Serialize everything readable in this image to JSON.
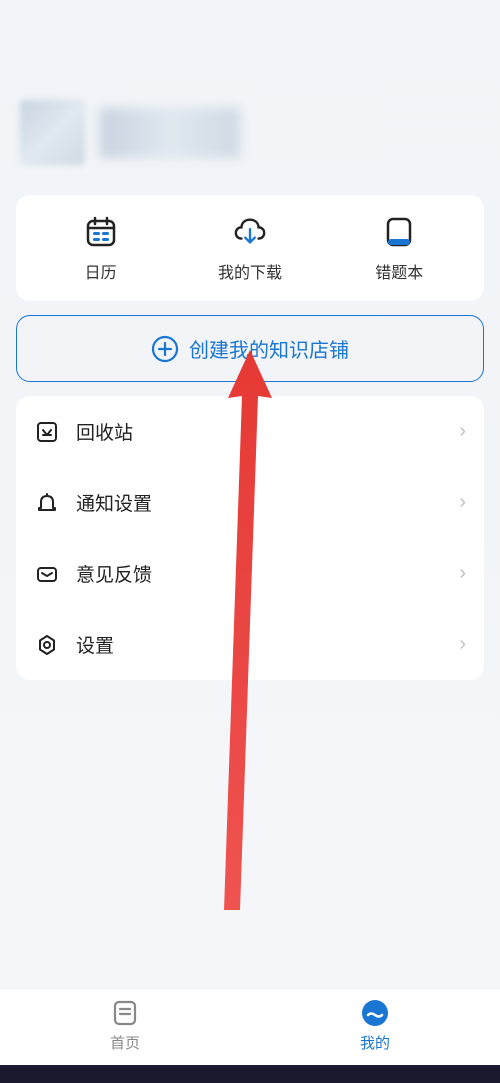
{
  "quickActions": {
    "calendar": "日历",
    "downloads": "我的下载",
    "wrongbook": "错题本"
  },
  "createStore": {
    "label": "创建我的知识店铺"
  },
  "settingsList": {
    "recycle": "回收站",
    "notification": "通知设置",
    "feedback": "意见反馈",
    "settings": "设置"
  },
  "bottomNav": {
    "home": "首页",
    "mine": "我的"
  },
  "colors": {
    "primary": "#1976d2",
    "text": "#222222"
  }
}
